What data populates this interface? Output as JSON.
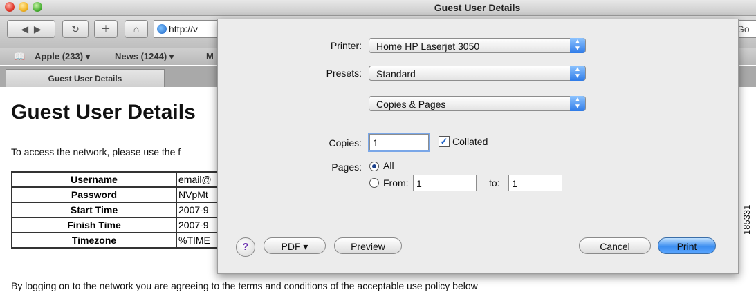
{
  "window": {
    "title": "Guest User Details"
  },
  "browser": {
    "url": "http://v",
    "search_partial": "Go",
    "bookmarks": [
      "Apple (233) ▾",
      "News (1244) ▾",
      "M"
    ],
    "tab_label": "Guest User Details"
  },
  "page": {
    "heading": "Guest User Details",
    "intro": "To access the network, please use the f",
    "rows": [
      {
        "key": "Username",
        "value": "email@"
      },
      {
        "key": "Password",
        "value": "NVpMt"
      },
      {
        "key": "Start Time",
        "value": "2007-9"
      },
      {
        "key": "Finish Time",
        "value": "2007-9"
      },
      {
        "key": "Timezone",
        "value": "%TIME"
      }
    ],
    "agreement": "By logging on to the network you are agreeing to the terms and conditions of the acceptable use policy below"
  },
  "print_dialog": {
    "printer_label": "Printer:",
    "printer_value": "Home HP Laserjet 3050",
    "presets_label": "Presets:",
    "presets_value": "Standard",
    "section_value": "Copies & Pages",
    "copies_label": "Copies:",
    "copies_value": "1",
    "collated_label": "Collated",
    "collated_checked": true,
    "pages_label": "Pages:",
    "all_label": "All",
    "from_label": "From:",
    "from_value": "1",
    "to_label": "to:",
    "to_value": "1",
    "help_label": "?",
    "pdf_label": "PDF ▾",
    "preview_label": "Preview",
    "cancel_label": "Cancel",
    "print_label": "Print"
  },
  "figure_id": "185331",
  "colors": {
    "primary_button": "#3d8ef0",
    "popup_arrows": "#2f7be8"
  },
  "icons": [
    "back-icon",
    "forward-icon",
    "reload-icon",
    "add-bookmark-icon",
    "home-icon",
    "globe-icon",
    "bookmarks-book-icon",
    "help-icon"
  ]
}
